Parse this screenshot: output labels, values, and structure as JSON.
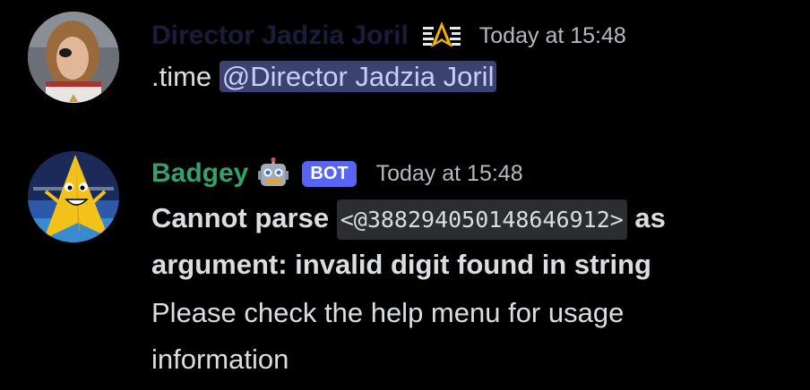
{
  "messages": [
    {
      "username": "Director Jadzia Joril",
      "username_color": "#1a1d3a",
      "role_icon": "starfleet-delta-icon",
      "timestamp": "Today at 15:48",
      "content_prefix": ".time ",
      "mention": "@Director Jadzia Joril"
    },
    {
      "username": "Badgey",
      "username_color": "#34a06a",
      "emoji": "robot-emoji-icon",
      "bot_tag": "BOT",
      "timestamp": "Today at 15:48",
      "error_prefix": "Cannot parse ",
      "error_code": "<@388294050148646912>",
      "error_suffix": " as",
      "error_line2": "argument: invalid digit found in string",
      "help_line1": "Please check the help menu for usage",
      "help_line2": "information"
    }
  ]
}
